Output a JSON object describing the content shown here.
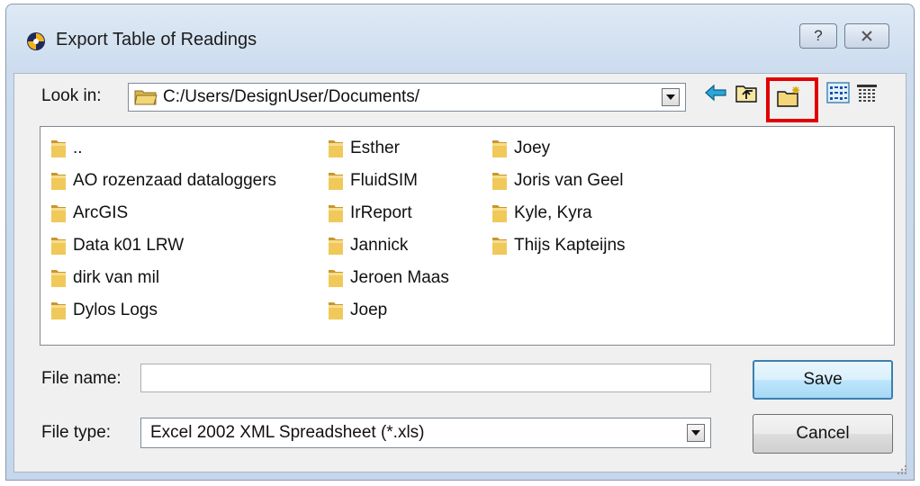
{
  "window": {
    "title": "Export Table of Readings",
    "help_label": "?",
    "close_label": "X"
  },
  "look_in": {
    "label": "Look in:",
    "path": "C:/Users/DesignUser/Documents/"
  },
  "toolbar": {
    "icons": [
      "back-arrow-icon",
      "up-folder-icon",
      "new-folder-icon",
      "list-view-icon",
      "detail-view-icon"
    ],
    "highlighted": "new-folder-icon"
  },
  "folders": {
    "col1": [
      "..",
      "AO rozenzaad dataloggers",
      "ArcGIS",
      "Data k01 LRW",
      "dirk van mil",
      "Dylos Logs"
    ],
    "col2": [
      "Esther",
      "FluidSIM",
      "IrReport",
      "Jannick",
      "Jeroen Maas",
      "Joep"
    ],
    "col3": [
      "Joey",
      "Joris van Geel",
      "Kyle, Kyra",
      "Thijs Kapteijns"
    ]
  },
  "file_name": {
    "label": "File name:",
    "value": ""
  },
  "file_type": {
    "label": "File type:",
    "value": "Excel 2002 XML Spreadsheet (*.xls)"
  },
  "buttons": {
    "save": "Save",
    "cancel": "Cancel"
  },
  "colors": {
    "highlight": "#e00000",
    "folder": "#e8c05a",
    "back_arrow": "#2aa6d8"
  }
}
